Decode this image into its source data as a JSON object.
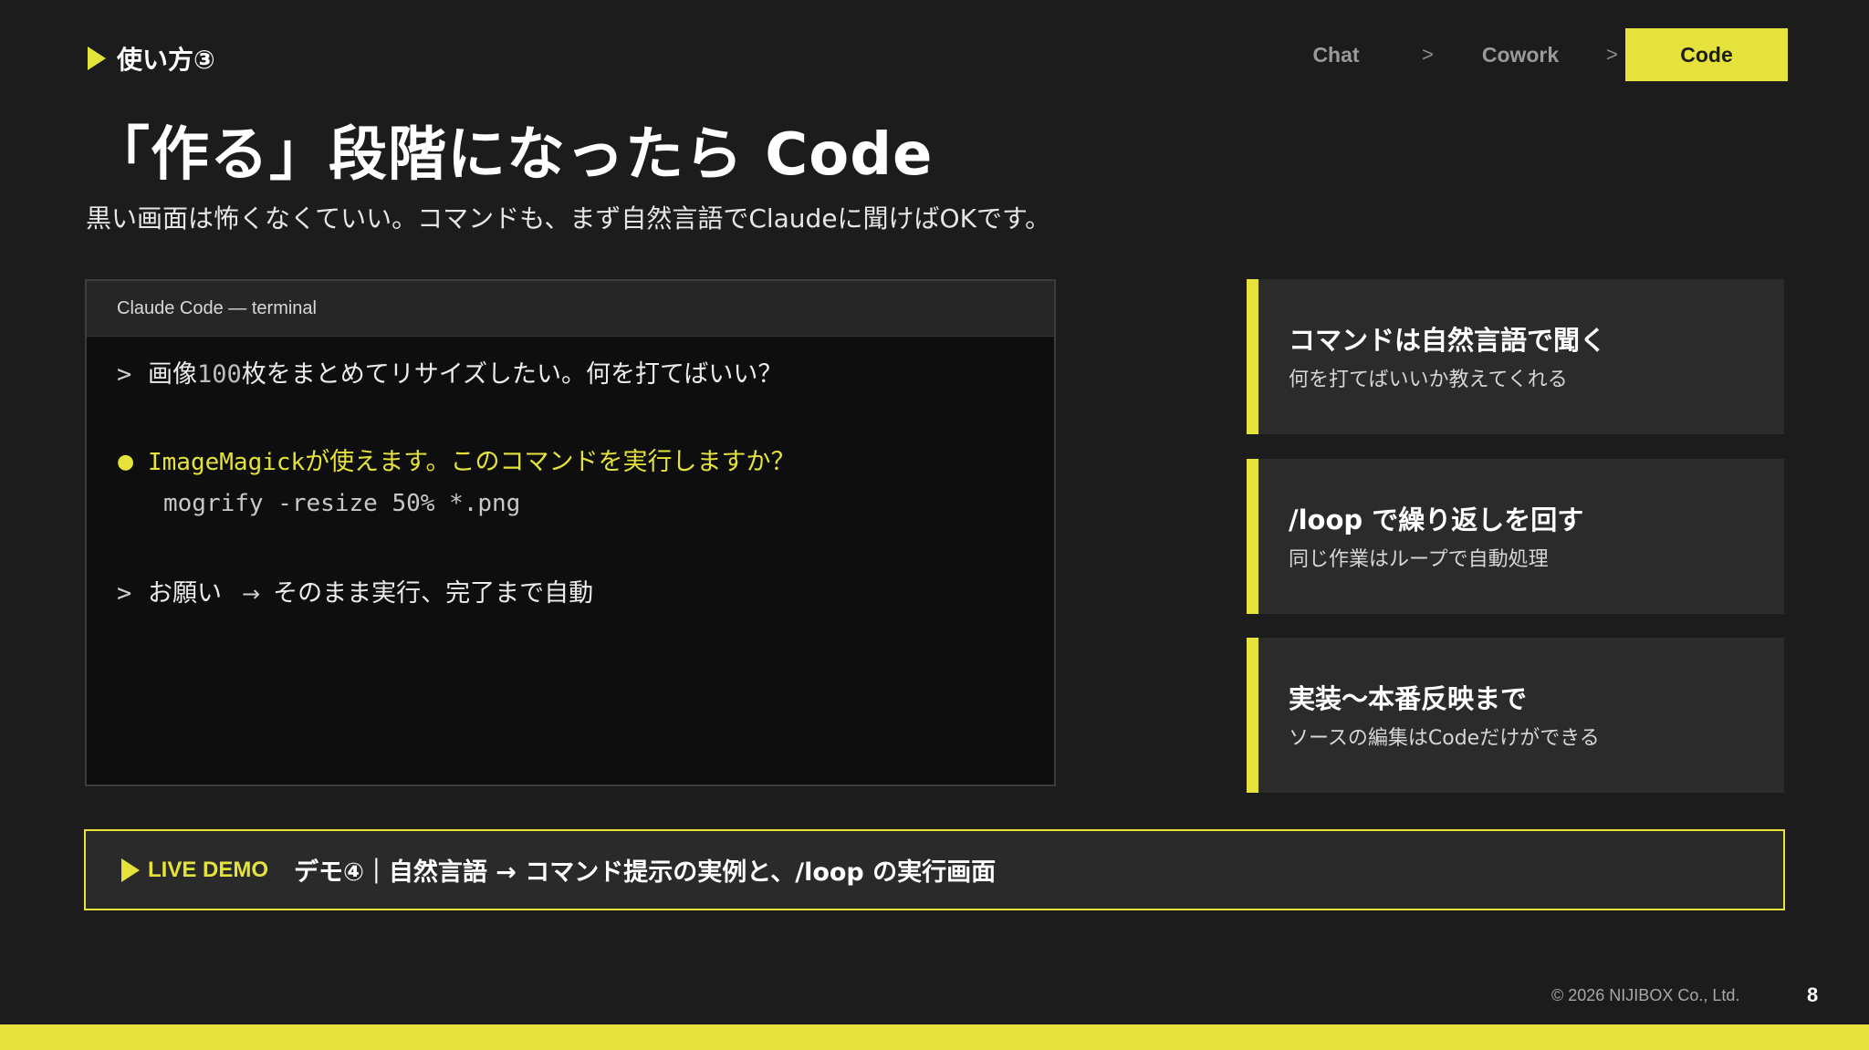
{
  "header": {
    "section_label": "使い方③",
    "steps": {
      "chat": "Chat",
      "sep1": ">",
      "cowork": "Cowork",
      "sep2": ">",
      "code": "Code"
    }
  },
  "main": {
    "title": "「作る」段階になったら Code",
    "subtitle": "黒い画面は怖くなくていい。コマンドも、まず自然言語でClaudeに聞けばOKです。"
  },
  "terminal": {
    "title": "Claude Code — terminal",
    "lines": {
      "user1_prompt": ">",
      "user1_text_a": "画像",
      "user1_text_num": "100",
      "user1_text_b": "枚をまとめてリサイズしたい。何を打てばいい？",
      "ai_bullet": "●",
      "ai_mono": "ImageMagick",
      "ai_text": "が使えます。このコマンドを実行しますか？",
      "command": "mogrify -resize 50% *.png",
      "user2_prompt": ">",
      "user2_text": "お願い",
      "user2_arrow": "→",
      "user2_result": "そのまま実行、完了まで自動"
    }
  },
  "cards": [
    {
      "title": "コマンドは自然言語で聞く",
      "desc": "何を打てばいいか教えてくれる"
    },
    {
      "title": "/loop で繰り返しを回す",
      "desc": "同じ作業はループで自動処理"
    },
    {
      "title": "実装〜本番反映まで",
      "desc": "ソースの編集はCodeだけができる"
    }
  ],
  "demo": {
    "tag": "LIVE DEMO",
    "text": "デモ④｜自然言語 → コマンド提示の実例と、/loop の実行画面"
  },
  "footer": {
    "copyright": "© 2026 NIJIBOX Co., Ltd.",
    "page_number": "8"
  },
  "colors": {
    "accent": "#e4e23b",
    "background": "#1c1c1c",
    "card": "#2b2b2b",
    "terminal": "#0e0e0e"
  }
}
